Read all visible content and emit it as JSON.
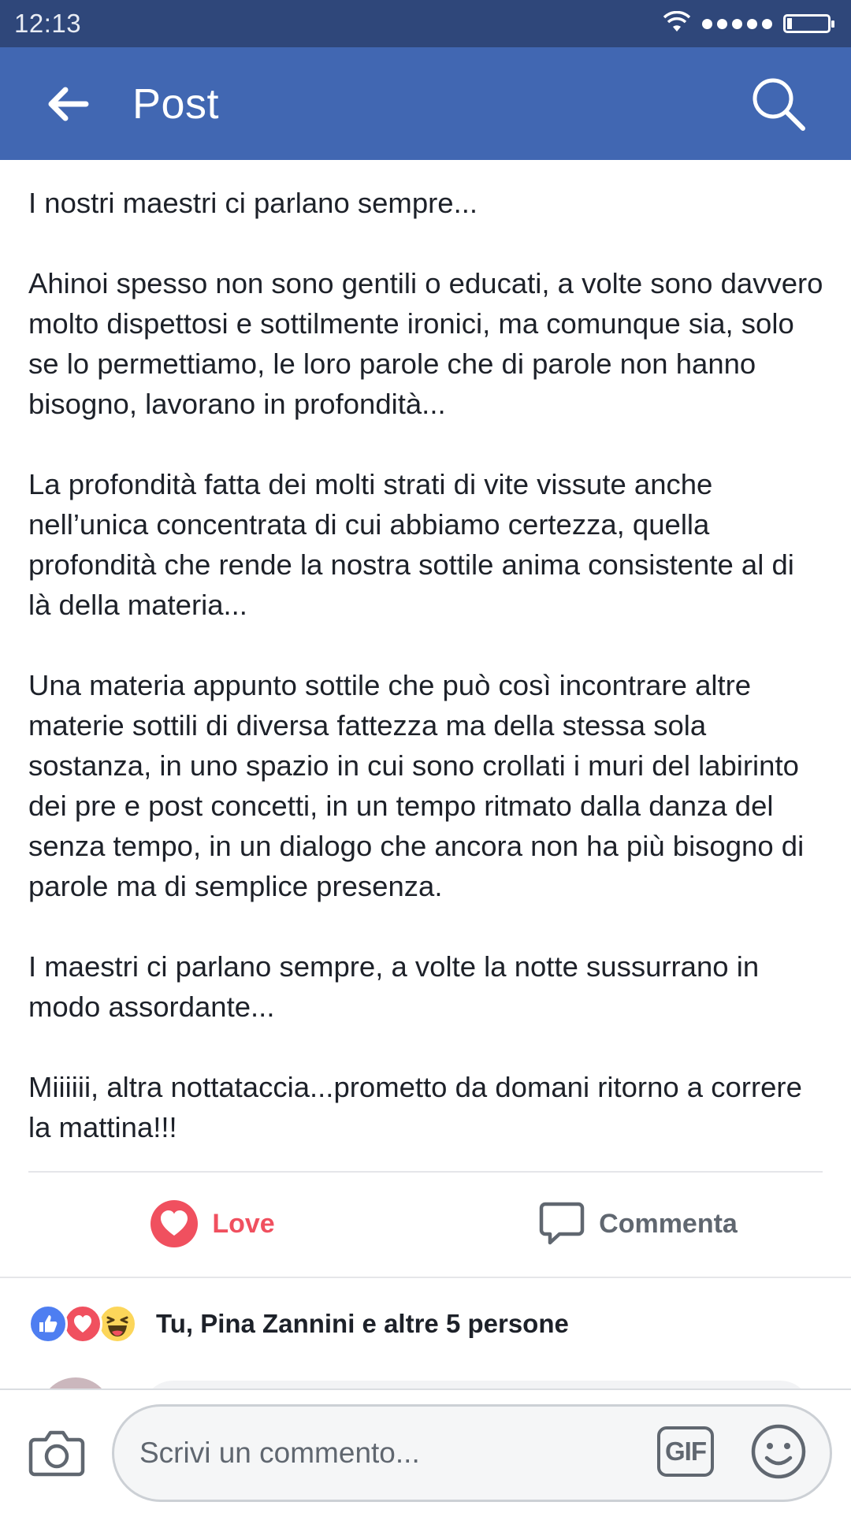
{
  "status_bar": {
    "time": "12:13"
  },
  "header": {
    "title": "Post"
  },
  "post": {
    "paragraphs": [
      "I nostri maestri ci parlano sempre...",
      "Ahinoi spesso non sono gentili o educati, a volte sono davvero molto dispettosi e sottilmente ironici, ma comunque sia, solo se lo permettiamo, le loro parole che di parole non hanno bisogno, lavorano in profondità...",
      "La profondità fatta dei molti strati di vite vissute anche nell’unica concentrata di cui abbiamo certezza, quella profondità che rende la nostra sottile anima consistente al di là della materia...",
      "Una materia appunto sottile che può così incontrare altre materie sottili di diversa fattezza ma della stessa sola sostanza, in uno spazio in cui sono crollati i muri del labirinto dei pre e post concetti, in un tempo ritmato dalla danza del senza tempo, in un dialogo che ancora non ha più bisogno di parole ma di semplice presenza.",
      "I maestri ci parlano sempre, a volte la notte sussurrano in modo assordante...",
      "Miiiiii, altra nottataccia...prometto da domani ritorno a correre la mattina!!!"
    ]
  },
  "actions": {
    "love_label": "Love",
    "comment_label": "Commenta"
  },
  "reactions": {
    "summary": "Tu, Pina Zannini e altre 5 persone",
    "icons": [
      "like-icon",
      "love-icon",
      "haha-icon"
    ]
  },
  "composer": {
    "placeholder": "Scrivi un commento...",
    "gif_label": "GIF"
  },
  "colors": {
    "status_bar": "#2f477a",
    "header": "#4167b2",
    "love": "#f0505f",
    "like": "#4e7ef1",
    "haha": "#fcd65a",
    "muted_text": "#606770"
  }
}
